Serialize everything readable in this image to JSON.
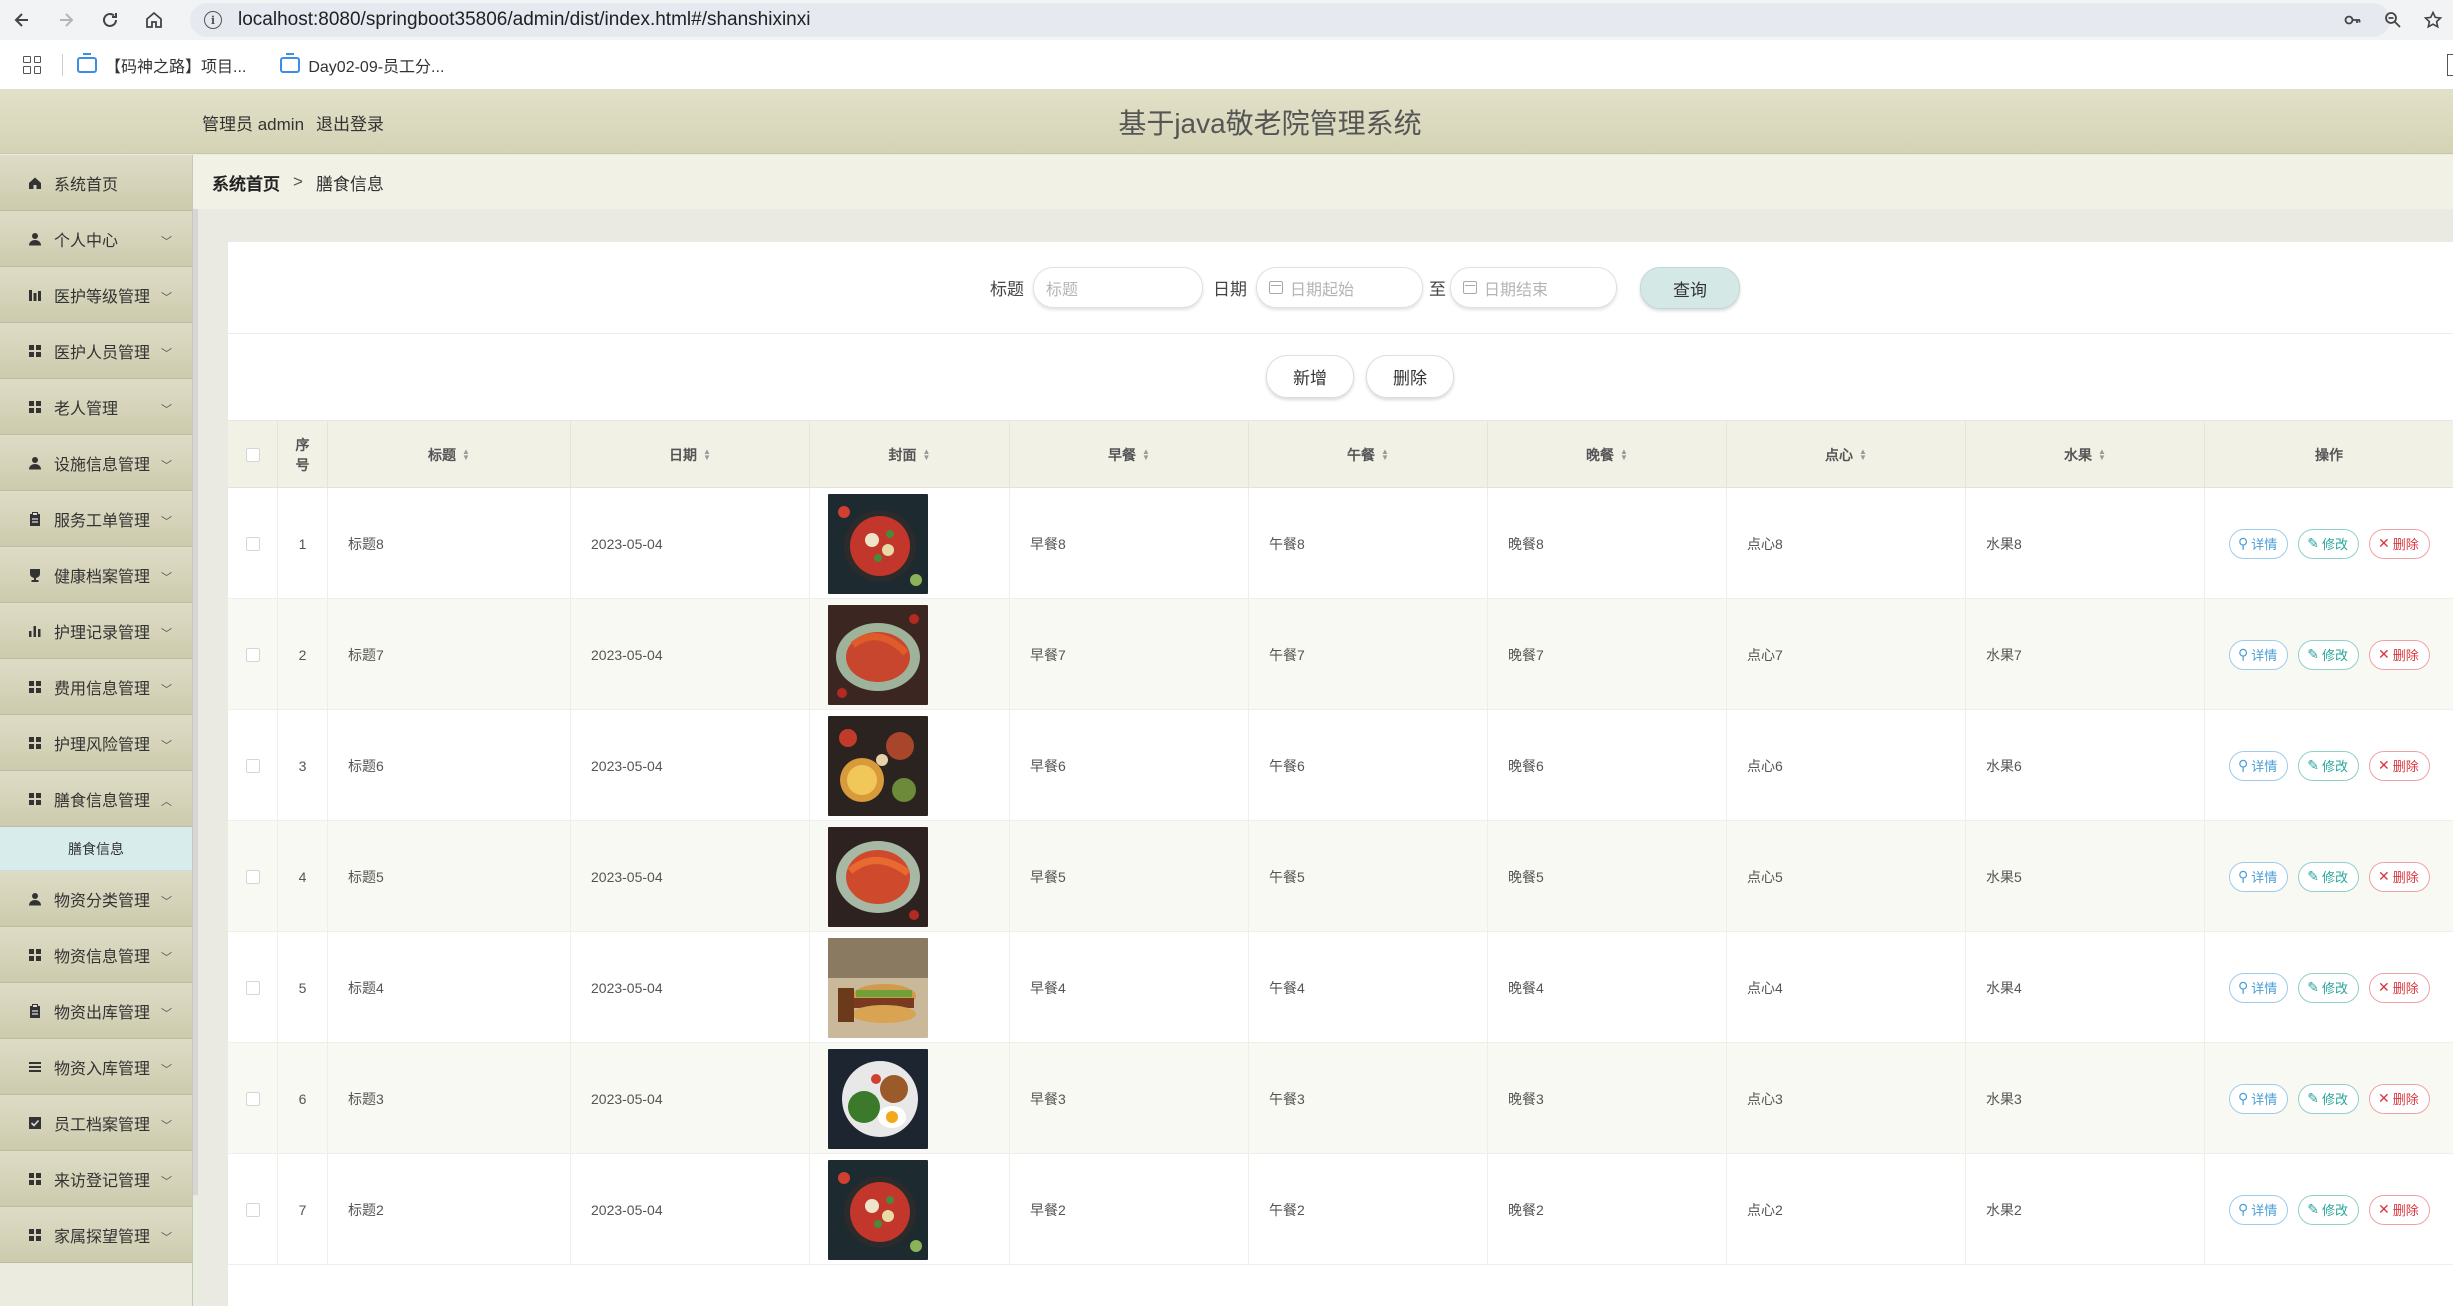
{
  "browser": {
    "url": "localhost:8080/springboot35806/admin/dist/index.html#/shanshixinxi",
    "bookmarks": [
      "【码神之路】项目...",
      "Day02-09-员工分..."
    ]
  },
  "header": {
    "role_user": "管理员 admin",
    "logout": "退出登录",
    "title": "基于java敬老院管理系统"
  },
  "sidebar": {
    "items": [
      {
        "label": "系统首页",
        "icon": "home-icon"
      },
      {
        "label": "个人中心",
        "icon": "user-icon"
      },
      {
        "label": "医护等级管理",
        "icon": "bars-icon"
      },
      {
        "label": "医护人员管理",
        "icon": "grid-icon"
      },
      {
        "label": "老人管理",
        "icon": "grid-icon"
      },
      {
        "label": "设施信息管理",
        "icon": "user-icon"
      },
      {
        "label": "服务工单管理",
        "icon": "clipboard-icon"
      },
      {
        "label": "健康档案管理",
        "icon": "cup-icon"
      },
      {
        "label": "护理记录管理",
        "icon": "chart-icon"
      },
      {
        "label": "费用信息管理",
        "icon": "grid-icon"
      },
      {
        "label": "护理风险管理",
        "icon": "grid-icon"
      },
      {
        "label": "膳食信息管理",
        "icon": "grid-icon"
      },
      {
        "label": "物资分类管理",
        "icon": "user-icon"
      },
      {
        "label": "物资信息管理",
        "icon": "grid-icon"
      },
      {
        "label": "物资出库管理",
        "icon": "clipboard-icon"
      },
      {
        "label": "物资入库管理",
        "icon": "list-icon"
      },
      {
        "label": "员工档案管理",
        "icon": "check-icon"
      },
      {
        "label": "来访登记管理",
        "icon": "grid-icon"
      },
      {
        "label": "家属探望管理",
        "icon": "grid-icon"
      }
    ],
    "sub_item": "膳食信息"
  },
  "breadcrumb": {
    "home": "系统首页",
    "separator": ">",
    "current": "膳食信息"
  },
  "search": {
    "title_label": "标题",
    "title_placeholder": "标题",
    "date_label": "日期",
    "date_start_placeholder": "日期起始",
    "to_label": "至",
    "date_end_placeholder": "日期结束",
    "query_button": "查询"
  },
  "actions": {
    "add": "新增",
    "delete": "删除"
  },
  "table": {
    "headers": {
      "seq": "序号",
      "title": "标题",
      "date": "日期",
      "cover": "封面",
      "breakfast": "早餐",
      "lunch": "午餐",
      "dinner": "晚餐",
      "snack": "点心",
      "fruit": "水果",
      "ops": "操作"
    },
    "op_labels": {
      "detail": "详情",
      "edit": "修改",
      "delete": "删除"
    },
    "rows": [
      {
        "seq": "1",
        "title": "标题8",
        "date": "2023-05-04",
        "breakfast": "早餐8",
        "lunch": "午餐8",
        "dinner": "晚餐8",
        "snack": "点心8",
        "fruit": "水果8"
      },
      {
        "seq": "2",
        "title": "标题7",
        "date": "2023-05-04",
        "breakfast": "早餐7",
        "lunch": "午餐7",
        "dinner": "晚餐7",
        "snack": "点心7",
        "fruit": "水果7"
      },
      {
        "seq": "3",
        "title": "标题6",
        "date": "2023-05-04",
        "breakfast": "早餐6",
        "lunch": "午餐6",
        "dinner": "晚餐6",
        "snack": "点心6",
        "fruit": "水果6"
      },
      {
        "seq": "4",
        "title": "标题5",
        "date": "2023-05-04",
        "breakfast": "早餐5",
        "lunch": "午餐5",
        "dinner": "晚餐5",
        "snack": "点心5",
        "fruit": "水果5"
      },
      {
        "seq": "5",
        "title": "标题4",
        "date": "2023-05-04",
        "breakfast": "早餐4",
        "lunch": "午餐4",
        "dinner": "晚餐4",
        "snack": "点心4",
        "fruit": "水果4"
      },
      {
        "seq": "6",
        "title": "标题3",
        "date": "2023-05-04",
        "breakfast": "早餐3",
        "lunch": "午餐3",
        "dinner": "晚餐3",
        "snack": "点心3",
        "fruit": "水果3"
      },
      {
        "seq": "7",
        "title": "标题2",
        "date": "2023-05-04",
        "breakfast": "早餐2",
        "lunch": "午餐2",
        "dinner": "晚餐2",
        "snack": "点心2",
        "fruit": "水果2"
      }
    ]
  }
}
